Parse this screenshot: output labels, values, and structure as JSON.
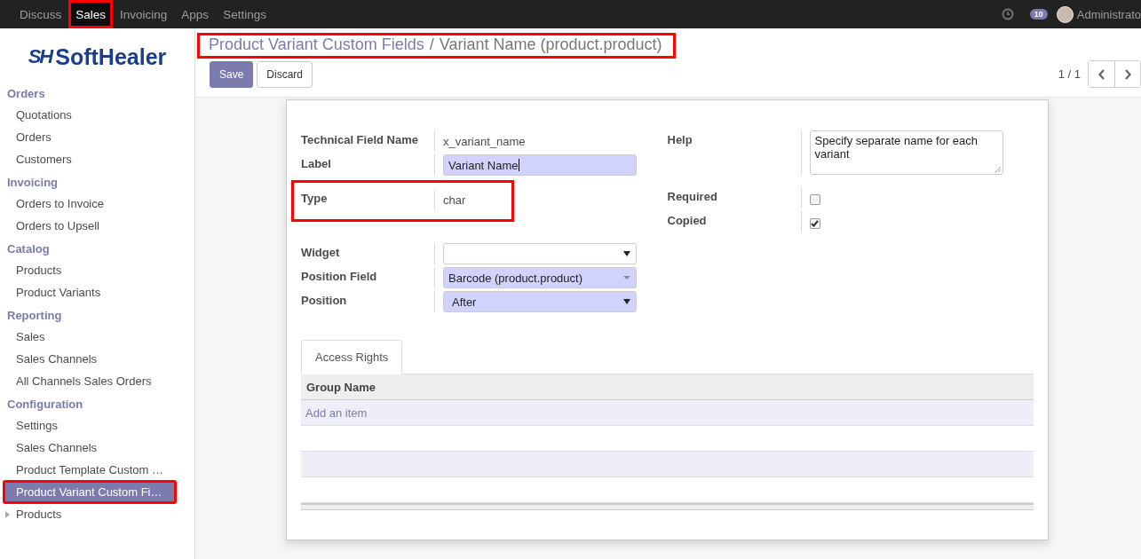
{
  "top_nav": {
    "apps": [
      {
        "label": "Discuss",
        "selected": false,
        "highlighted": false
      },
      {
        "label": "Sales",
        "selected": true,
        "highlighted": true
      },
      {
        "label": "Invoicing",
        "selected": false,
        "highlighted": false
      },
      {
        "label": "Apps",
        "selected": false,
        "highlighted": false
      },
      {
        "label": "Settings",
        "selected": false,
        "highlighted": false
      }
    ],
    "systray": {
      "message_count": "10",
      "user": "Administrato"
    }
  },
  "logo": {
    "mark": "SH",
    "name": "SoftHealer"
  },
  "sidebar": {
    "sections": [
      {
        "title": "Orders",
        "items": [
          {
            "label": "Quotations",
            "selected": false,
            "highlighted": false,
            "expandable": false
          },
          {
            "label": "Orders",
            "selected": false,
            "highlighted": false,
            "expandable": false
          },
          {
            "label": "Customers",
            "selected": false,
            "highlighted": false,
            "expandable": false
          }
        ]
      },
      {
        "title": "Invoicing",
        "items": [
          {
            "label": "Orders to Invoice",
            "selected": false,
            "highlighted": false,
            "expandable": false
          },
          {
            "label": "Orders to Upsell",
            "selected": false,
            "highlighted": false,
            "expandable": false
          }
        ]
      },
      {
        "title": "Catalog",
        "items": [
          {
            "label": "Products",
            "selected": false,
            "highlighted": false,
            "expandable": false
          },
          {
            "label": "Product Variants",
            "selected": false,
            "highlighted": false,
            "expandable": false
          }
        ]
      },
      {
        "title": "Reporting",
        "items": [
          {
            "label": "Sales",
            "selected": false,
            "highlighted": false,
            "expandable": false
          },
          {
            "label": "Sales Channels",
            "selected": false,
            "highlighted": false,
            "expandable": false
          },
          {
            "label": "All Channels Sales Orders",
            "selected": false,
            "highlighted": false,
            "expandable": false
          }
        ]
      },
      {
        "title": "Configuration",
        "items": [
          {
            "label": "Settings",
            "selected": false,
            "highlighted": false,
            "expandable": false
          },
          {
            "label": "Sales Channels",
            "selected": false,
            "highlighted": false,
            "expandable": false
          },
          {
            "label": "Product Template Custom …",
            "selected": false,
            "highlighted": false,
            "expandable": false
          },
          {
            "label": "Product Variant Custom Fi…",
            "selected": true,
            "highlighted": true,
            "expandable": false
          },
          {
            "label": "Products",
            "selected": false,
            "highlighted": false,
            "expandable": true
          }
        ]
      }
    ]
  },
  "breadcrumb": {
    "parent": "Product Variant Custom Fields",
    "separator": "/",
    "current": "Variant Name (product.product)",
    "highlighted": true
  },
  "buttons": [
    {
      "label": "Save",
      "kind": "primary"
    },
    {
      "label": "Discard",
      "kind": "secondary"
    }
  ],
  "pager": {
    "value": "1 / 1"
  },
  "form": {
    "left_fields": [
      {
        "label": "Technical Field Name",
        "kind": "text",
        "value": "x_variant_name",
        "highlighted": false
      },
      {
        "label": "Label",
        "kind": "input",
        "value": "Variant Name",
        "required": true,
        "highlighted": false
      },
      {
        "label": "Type",
        "kind": "text",
        "value": "char",
        "highlighted": true
      },
      {
        "label": "Widget",
        "kind": "select",
        "required": false,
        "highlighted": false
      },
      {
        "label": "Position Field",
        "kind": "many2one",
        "value": "Barcode (product.product)",
        "required": true,
        "highlighted": false
      },
      {
        "label": "Position",
        "kind": "select",
        "value": "After",
        "required": true,
        "highlighted": false
      }
    ],
    "right_fields": [
      {
        "label": "Help",
        "kind": "textarea",
        "value": "Specify separate name for each variant"
      },
      {
        "label": "Required",
        "kind": "checkbox",
        "checked": false
      },
      {
        "label": "Copied",
        "kind": "checkbox",
        "checked": true
      }
    ]
  },
  "notebook": {
    "tabs": [
      {
        "label": "Access Rights",
        "selected": true
      }
    ],
    "table": {
      "columns": [
        "Group Name"
      ],
      "add_item": "Add an item"
    }
  }
}
